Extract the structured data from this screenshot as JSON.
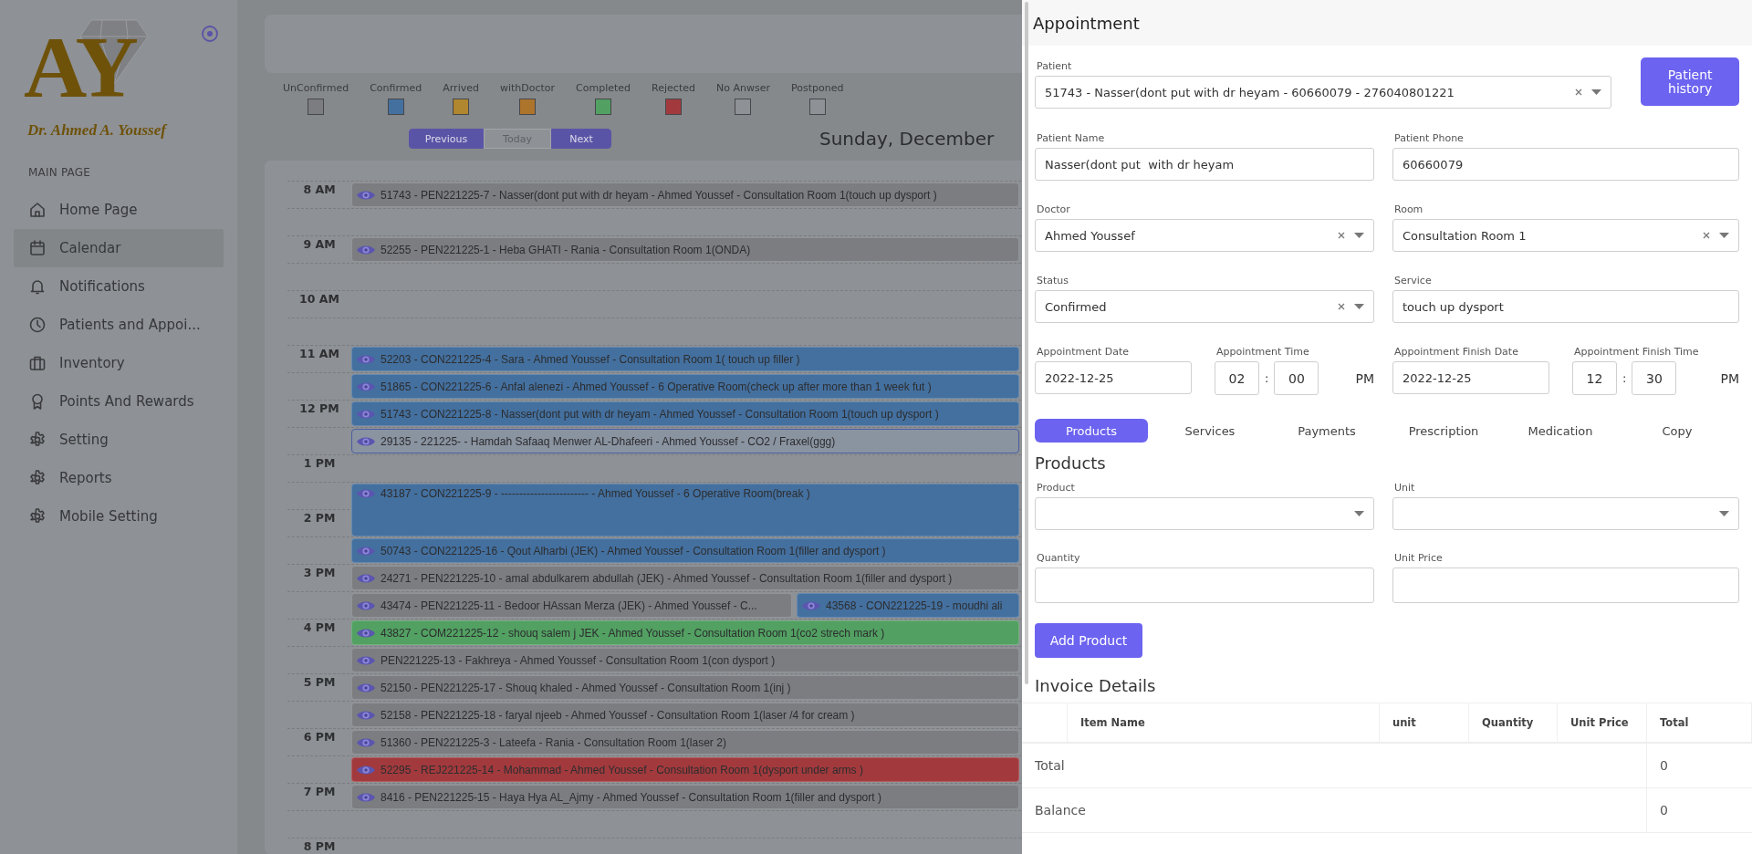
{
  "sidebar": {
    "logo": {
      "monogram": "AY",
      "caption": "Dr. Ahmed A. Youssef"
    },
    "section": "MAIN PAGE",
    "items": [
      {
        "label": "Home Page",
        "selected": false
      },
      {
        "label": "Calendar",
        "selected": true
      },
      {
        "label": "Notifications",
        "selected": false
      },
      {
        "label": "Patients and Appoi...",
        "selected": false
      },
      {
        "label": "Inventory",
        "selected": false
      },
      {
        "label": "Points And Rewards",
        "selected": false
      },
      {
        "label": "Setting",
        "selected": false
      },
      {
        "label": "Reports",
        "selected": false
      },
      {
        "label": "Mobile Setting",
        "selected": false
      }
    ]
  },
  "legend": [
    {
      "label": "UnConfirmed",
      "color": "#7b7d80"
    },
    {
      "label": "Confirmed",
      "color": "#44709f"
    },
    {
      "label": "Arrived",
      "color": "#b0862f"
    },
    {
      "label": "withDoctor",
      "color": "#ad742b"
    },
    {
      "label": "Completed",
      "color": "#52a062"
    },
    {
      "label": "Rejected",
      "color": "#a23a3d"
    },
    {
      "label": "No Anwser",
      "color": "#8e9195"
    },
    {
      "label": "Postponed",
      "color": "#8e9195"
    }
  ],
  "nav": {
    "buttons": [
      {
        "label": "Previous",
        "disabled": false
      },
      {
        "label": "Today",
        "disabled": true
      },
      {
        "label": "Next",
        "disabled": false
      }
    ],
    "date_title": "Sunday, December"
  },
  "calendar": {
    "hours": [
      {
        "time": "8 AM",
        "events": [
          {
            "text": "51743 - PEN221225-7 - Nasser(dont put with dr heyam - Ahmed Youssef - Consultation Room 1(touch up dysport )",
            "color": "#7b7d80",
            "kind": "filled"
          }
        ]
      },
      {
        "time": "9 AM",
        "events": [
          {
            "text": "52255 - PEN221225-1 - Heba GHATI - Rania - Consultation Room 1(ONDA)",
            "color": "#7b7d80",
            "kind": "filled"
          }
        ]
      },
      {
        "time": "10 AM"
      },
      {
        "time": "11 AM",
        "events": [
          {
            "text": "52203 - CON221225-4 - Sara - Ahmed Youssef - Consultation Room 1( touch up filler )",
            "color": "#44709f",
            "kind": "filled"
          }
        ],
        "half_events": [
          {
            "text": "51865 - CON221225-6 - Anfal alenezi - Ahmed Youssef - 6 Operative Room(check up after more than 1 week fut )",
            "color": "#44709f",
            "kind": "filled"
          }
        ]
      },
      {
        "time": "12 PM",
        "events": [
          {
            "text": "51743 - CON221225-8 - Nasser(dont put with dr heyam - Ahmed Youssef - Consultation Room 1(touch up dysport )",
            "color": "#44709f",
            "kind": "filled"
          }
        ],
        "half_events": [
          {
            "text": "29135 - 221225- - Hamdah Safaaq Menwer AL-Dhafeeri - Ahmed Youssef - CO2 / Fraxel(ggg)",
            "color": "#8a93a0",
            "kind": "outlined"
          }
        ]
      },
      {
        "time": "1 PM",
        "half_events": [
          {
            "text": "43187 - CON221225-9 - ------------------------ - Ahmed Youssef - 6 Operative Room(break )",
            "color": "#44709f",
            "kind": "tall"
          }
        ]
      },
      {
        "time": "2 PM",
        "half_events": [
          {
            "text": "50743 - CON221225-16 - Qout Alharbi (JEK) - Ahmed Youssef - Consultation Room 1(filler and dysport )",
            "color": "#44709f",
            "kind": "filled"
          }
        ]
      },
      {
        "time": "3 PM",
        "events": [
          {
            "text": "24271 - PEN221225-10 - amal abdulkarem abdullah (JEK) - Ahmed Youssef - Consultation Room 1(filler and dysport )",
            "color": "#7b7d80",
            "kind": "filled"
          }
        ],
        "half_events": [
          {
            "text": "43474 - PEN221225-11 - Bedoor HAssan Merza (JEK) - Ahmed Youssef - C...",
            "color": "#7b7d80",
            "kind": "filled"
          },
          {
            "text": "43568 - CON221225-19 - moudhi ali",
            "color": "#44709f",
            "kind": "filled"
          }
        ]
      },
      {
        "time": "4 PM",
        "events": [
          {
            "text": "43827 - COM221225-12 - shouq salem j JEK - Ahmed Youssef - Consultation Room 1(co2 strech mark )",
            "color": "#52a062",
            "kind": "filled"
          }
        ],
        "half_events": [
          {
            "text": "PEN221225-13 - Fakhreya - Ahmed Youssef - Consultation Room 1(con dysport )",
            "color": "#7b7d80",
            "kind": "filled"
          }
        ]
      },
      {
        "time": "5 PM",
        "events": [
          {
            "text": "52150 - PEN221225-17 - Shouq khaled - Ahmed Youssef - Consultation Room 1(inj )",
            "color": "#7b7d80",
            "kind": "filled"
          }
        ],
        "half_events": [
          {
            "text": "52158 - PEN221225-18 - faryal njeeb - Ahmed Youssef - Consultation Room 1(laser /4 for cream )",
            "color": "#7b7d80",
            "kind": "filled"
          }
        ]
      },
      {
        "time": "6 PM",
        "events": [
          {
            "text": "51360 - PEN221225-3 - Lateefa - Rania - Consultation Room 1(laser 2)",
            "color": "#7b7d80",
            "kind": "filled"
          }
        ],
        "half_events": [
          {
            "text": "52295 - REJ221225-14 - Mohammad - Ahmed Youssef - Consultation Room 1(dysport under arms )",
            "color": "#a23a3d",
            "kind": "filled"
          }
        ]
      },
      {
        "time": "7 PM",
        "events": [
          {
            "text": "8416 - PEN221225-15 - Haya Hya AL_Ajmy - Ahmed Youssef - Consultation Room 1(filler and dysport )",
            "color": "#7b7d80",
            "kind": "filled"
          }
        ]
      },
      {
        "time": "8 PM"
      }
    ]
  },
  "panel": {
    "title": "Appointment",
    "patient": {
      "label": "Patient",
      "value": "51743 - Nasser(dont put with dr heyam - 60660079 - 276040801221",
      "clearable": true
    },
    "history_button": "Patient history",
    "fields": [
      {
        "label": "Patient Name",
        "kind": "text",
        "value": "Nasser(dont put  with dr heyam"
      },
      {
        "label": "Patient Phone",
        "kind": "text",
        "value": "60660079"
      },
      {
        "label": "Doctor",
        "kind": "select",
        "value": "Ahmed Youssef",
        "clearable": true
      },
      {
        "label": "Room",
        "kind": "select",
        "value": "Consultation Room 1",
        "clearable": true
      },
      {
        "label": "Status",
        "kind": "select",
        "value": "Confirmed",
        "clearable": true
      },
      {
        "label": "Service",
        "kind": "text",
        "value": "touch up dysport"
      }
    ],
    "schedule": [
      {
        "label": "Appointment Date",
        "kind": "date",
        "value": "2022-12-25"
      },
      {
        "label": "Appointment Time",
        "kind": "time",
        "hour": "02",
        "separator": ":",
        "minute": "00",
        "meridiem": "PM"
      },
      {
        "label": "Appointment Finish Date",
        "kind": "date",
        "value": "2022-12-25"
      },
      {
        "label": "Appointment Finish Time",
        "kind": "time",
        "hour": "12",
        "separator": ":",
        "minute": "30",
        "meridiem": "PM"
      }
    ],
    "tabs": [
      {
        "label": "Products",
        "selected": true
      },
      {
        "label": "Services",
        "selected": false
      },
      {
        "label": "Payments",
        "selected": false
      },
      {
        "label": "Prescription",
        "selected": false
      },
      {
        "label": "Medication",
        "selected": false
      },
      {
        "label": "Copy",
        "selected": false
      }
    ],
    "products": {
      "title": "Products",
      "fields": [
        {
          "label": "Product",
          "kind": "select",
          "clearable": false
        },
        {
          "label": "Unit",
          "kind": "select",
          "clearable": false
        },
        {
          "label": "Quantity",
          "kind": "text"
        },
        {
          "label": "Unit Price",
          "kind": "text"
        }
      ],
      "button": "Add Product"
    },
    "invoice": {
      "title": "Invoice Details",
      "columns": [
        "Item Name",
        "unit",
        "Quantity",
        "Unit Price",
        "Total"
      ],
      "rows": [
        {
          "label": "Total",
          "total": "0"
        },
        {
          "label": "Balance",
          "total": "0"
        }
      ]
    }
  }
}
